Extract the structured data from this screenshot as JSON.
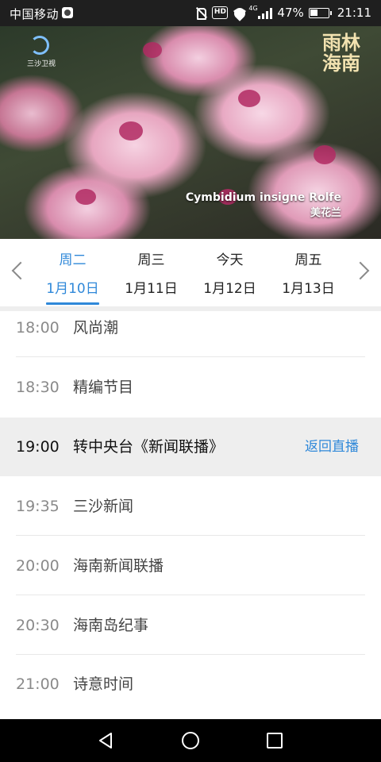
{
  "status_bar": {
    "carrier": "中国移动",
    "network": "4G",
    "hd_label": "HD",
    "battery": "47%",
    "time": "21:11"
  },
  "banner": {
    "logo_text": "三沙卫视",
    "badge_line1": "雨林",
    "badge_line2": "海南",
    "caption_latin": "Cymbidium insigne Rolfe",
    "caption_chinese": "美花兰"
  },
  "date_tabs": [
    {
      "weekday": "周二",
      "date": "1月10日",
      "active": true
    },
    {
      "weekday": "周三",
      "date": "1月11日",
      "active": false
    },
    {
      "weekday": "今天",
      "date": "1月12日",
      "active": false
    },
    {
      "weekday": "周五",
      "date": "1月13日",
      "active": false
    }
  ],
  "schedule": [
    {
      "time": "18:00",
      "title": "风尚潮"
    },
    {
      "time": "18:30",
      "title": "精编节目"
    },
    {
      "time": "19:00",
      "title": "转中央台《新闻联播》",
      "live": true,
      "action": "返回直播"
    },
    {
      "time": "19:35",
      "title": "三沙新闻"
    },
    {
      "time": "20:00",
      "title": "海南新闻联播"
    },
    {
      "time": "20:30",
      "title": "海南岛纪事"
    },
    {
      "time": "21:00",
      "title": "诗意时间"
    }
  ],
  "colors": {
    "accent": "#2f88d9",
    "live_row_bg": "#eeeeee"
  },
  "icons": [
    "mute-icon",
    "wifi-icon",
    "signal-icon",
    "battery-icon",
    "chevron-left-icon",
    "chevron-right-icon",
    "back-icon",
    "home-icon",
    "recent-apps-icon"
  ]
}
